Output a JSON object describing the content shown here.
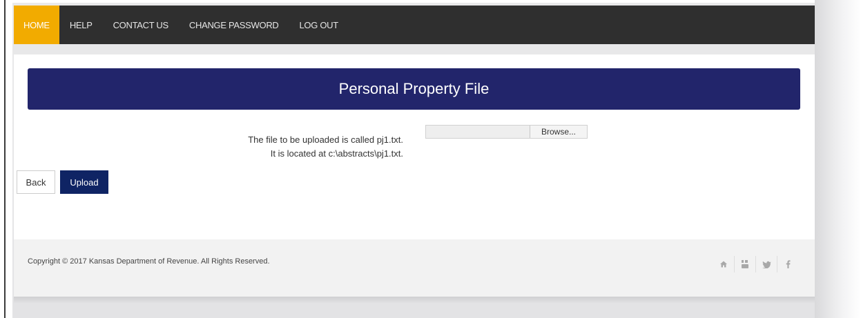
{
  "nav": {
    "items": [
      {
        "label": "HOME",
        "active": true
      },
      {
        "label": "HELP",
        "active": false
      },
      {
        "label": "CONTACT US",
        "active": false
      },
      {
        "label": "CHANGE PASSWORD",
        "active": false
      },
      {
        "label": "LOG OUT",
        "active": false
      }
    ],
    "active_color": "#f2ab00"
  },
  "banner": {
    "title": "Personal Property File",
    "color": "#22256b"
  },
  "upload": {
    "info_line_1": "The file to be uploaded is called pj1.txt.",
    "info_line_2": "It is located at c:\\abstracts\\pj1.txt.",
    "browse_label": "Browse...",
    "back_label": "Back",
    "upload_label": "Upload"
  },
  "footer": {
    "copyright": "Copyright © 2017 Kansas Department of Revenue. All Rights Reserved.",
    "social_icons": [
      "home-icon",
      "youtube-icon",
      "twitter-icon",
      "facebook-icon"
    ]
  }
}
